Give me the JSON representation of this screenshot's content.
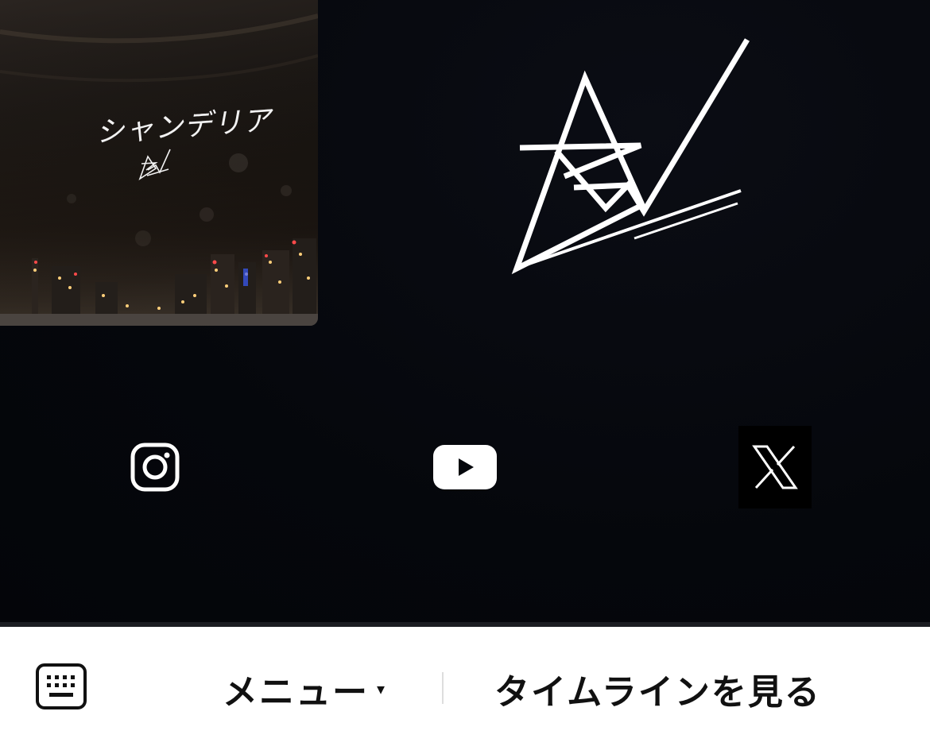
{
  "rich_menu": {
    "album": {
      "title": "シャンデリア",
      "logo_icon": "rew-mini-logo-icon"
    },
    "brand_logo_icon": "rew-logo-icon",
    "socials": [
      {
        "name": "Instagram",
        "icon": "instagram-icon"
      },
      {
        "name": "YouTube",
        "icon": "youtube-icon"
      },
      {
        "name": "X",
        "icon": "x-logo-icon"
      }
    ]
  },
  "bottom_bar": {
    "keyboard_icon": "keyboard-icon",
    "menu_label": "メニュー",
    "menu_caret": "▾",
    "timeline_label": "タイムラインを見る"
  },
  "colors": {
    "background_dark": "#05070c",
    "icon_white": "#ffffff",
    "bar_background": "#ffffff",
    "bar_text": "#111111",
    "separator": "#dedede"
  }
}
